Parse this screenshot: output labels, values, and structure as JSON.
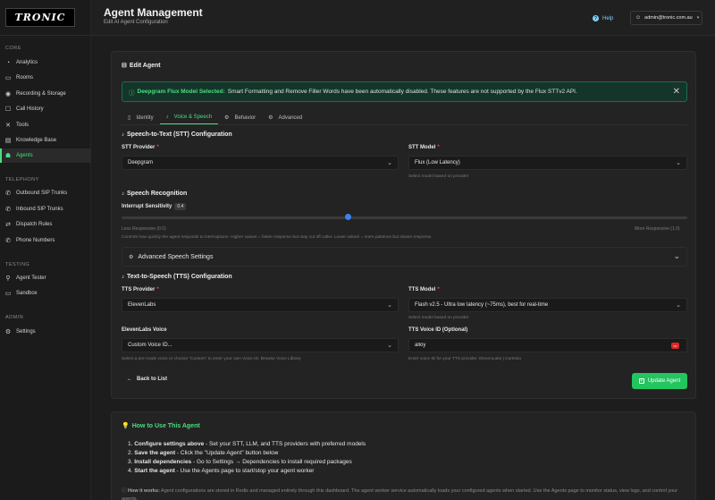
{
  "sidebar": {
    "logo_text": "TRONIC",
    "sections": [
      {
        "title": "CORE",
        "items": [
          {
            "label": "Analytics",
            "icon": "analytics-icon",
            "glyph": "◔"
          },
          {
            "label": "Rooms",
            "icon": "rooms-icon",
            "glyph": "▭"
          },
          {
            "label": "Recording & Storage",
            "icon": "recording-icon",
            "glyph": "◉"
          },
          {
            "label": "Call History",
            "icon": "call-history-icon",
            "glyph": "☐"
          },
          {
            "label": "Tools",
            "icon": "tools-icon",
            "glyph": "✕"
          },
          {
            "label": "Knowledge Base",
            "icon": "knowledge-base-icon",
            "glyph": "▤"
          },
          {
            "label": "Agents",
            "icon": "agents-icon",
            "glyph": "☗",
            "active": true
          }
        ]
      },
      {
        "title": "TELEPHONY",
        "items": [
          {
            "label": "Outbound SIP Trunks",
            "icon": "outbound-trunk-icon",
            "glyph": "✆"
          },
          {
            "label": "Inbound SIP Trunks",
            "icon": "inbound-trunk-icon",
            "glyph": "✆"
          },
          {
            "label": "Dispatch Rules",
            "icon": "dispatch-icon",
            "glyph": "⇄"
          },
          {
            "label": "Phone Numbers",
            "icon": "phone-icon",
            "glyph": "✆"
          }
        ]
      },
      {
        "title": "TESTING",
        "items": [
          {
            "label": "Agent Tester",
            "icon": "tester-icon",
            "glyph": "⚲"
          },
          {
            "label": "Sandbox",
            "icon": "sandbox-icon",
            "glyph": "▭"
          }
        ]
      },
      {
        "title": "ADMIN",
        "items": [
          {
            "label": "Settings",
            "icon": "settings-icon",
            "glyph": "⚙"
          }
        ]
      }
    ]
  },
  "header": {
    "title": "Agent Management",
    "subtitle": "Edit AI Agent Configuration",
    "help_label": "Help",
    "user_email": "admin@tronic.com.au"
  },
  "edit_card": {
    "title": "Edit Agent",
    "alert": {
      "title": "Deepgram Flux Model Selected:",
      "message": "Smart Formatting and Remove Filler Words have been automatically disabled. These features are not supported by the Flux STTv2 API."
    },
    "tabs": [
      {
        "label": "Identity",
        "icon": "identity-icon",
        "glyph": "▯"
      },
      {
        "label": "Voice & Speech",
        "icon": "voice-icon",
        "glyph": "🎙",
        "active": true
      },
      {
        "label": "Behavior",
        "icon": "behavior-icon",
        "glyph": "⚙"
      },
      {
        "label": "Advanced",
        "icon": "advanced-icon",
        "glyph": "⚙"
      }
    ],
    "stt": {
      "heading": "Speech-to-Text (STT) Configuration",
      "provider_label": "STT Provider",
      "provider_value": "Deepgram",
      "model_label": "STT Model",
      "model_value": "Flux (Low Latency)",
      "model_hint": "Select model based on provider"
    },
    "recognition": {
      "heading": "Speech Recognition",
      "sensitivity_label": "Interrupt Sensitivity",
      "sensitivity_value": "0.4",
      "sensitivity_fraction": 0.4,
      "min_label": "Less Responsive (0.0)",
      "max_label": "More Responsive (1.0)",
      "hint": "Controls how quickly the agent responds to interruptions. Higher values = faster response but may cut off caller. Lower values = more patience but slower response."
    },
    "advanced_speech": {
      "label": "Advanced Speech Settings"
    },
    "tts": {
      "heading": "Text-to-Speech (TTS) Configuration",
      "provider_label": "TTS Provider",
      "provider_value": "ElevenLabs",
      "model_label": "TTS Model",
      "model_value": "Flash v2.5 - Ultra low latency (~75ms), best for real-time",
      "model_hint": "Select model based on provider",
      "voice_label": "ElevenLabs Voice",
      "voice_value": "Custom Voice ID...",
      "voice_hint": "Select a pre-made voice or choose \"Custom\" to enter your own Voice ID. Browse Voice Library",
      "voice_id_label": "TTS Voice ID (Optional)",
      "voice_id_value": "alloy",
      "voice_id_hint": "Enter voice ID for your TTS provider. ElevenLabs | Cartesia"
    },
    "back_label": "Back to List",
    "update_label": "Update Agent"
  },
  "howto": {
    "title": "How to Use This Agent",
    "steps": [
      {
        "n": "1.",
        "bold": "Configure settings above",
        "text": " - Set your STT, LLM, and TTS providers with preferred models"
      },
      {
        "n": "2.",
        "bold": "Save the agent",
        "text": " - Click the \"Update Agent\" button below"
      },
      {
        "n": "3.",
        "bold": "Install dependencies",
        "text": " - Go to Settings → Dependencies to install required packages"
      },
      {
        "n": "4.",
        "bold": "Start the agent",
        "text": " - Use the Agents page to start/stop your agent worker"
      }
    ],
    "note_bold": "How it works:",
    "note": " Agent configurations are stored in Redis and managed entirely through this dashboard. The agent worker service automatically loads your configured agents when started. Use the Agents page to monitor status, view logs, and control your agents."
  },
  "colors": {
    "accent": "#4ade80",
    "alert_bg": "#16352a",
    "slider": "#3b82f6",
    "update": "#22c55e"
  }
}
